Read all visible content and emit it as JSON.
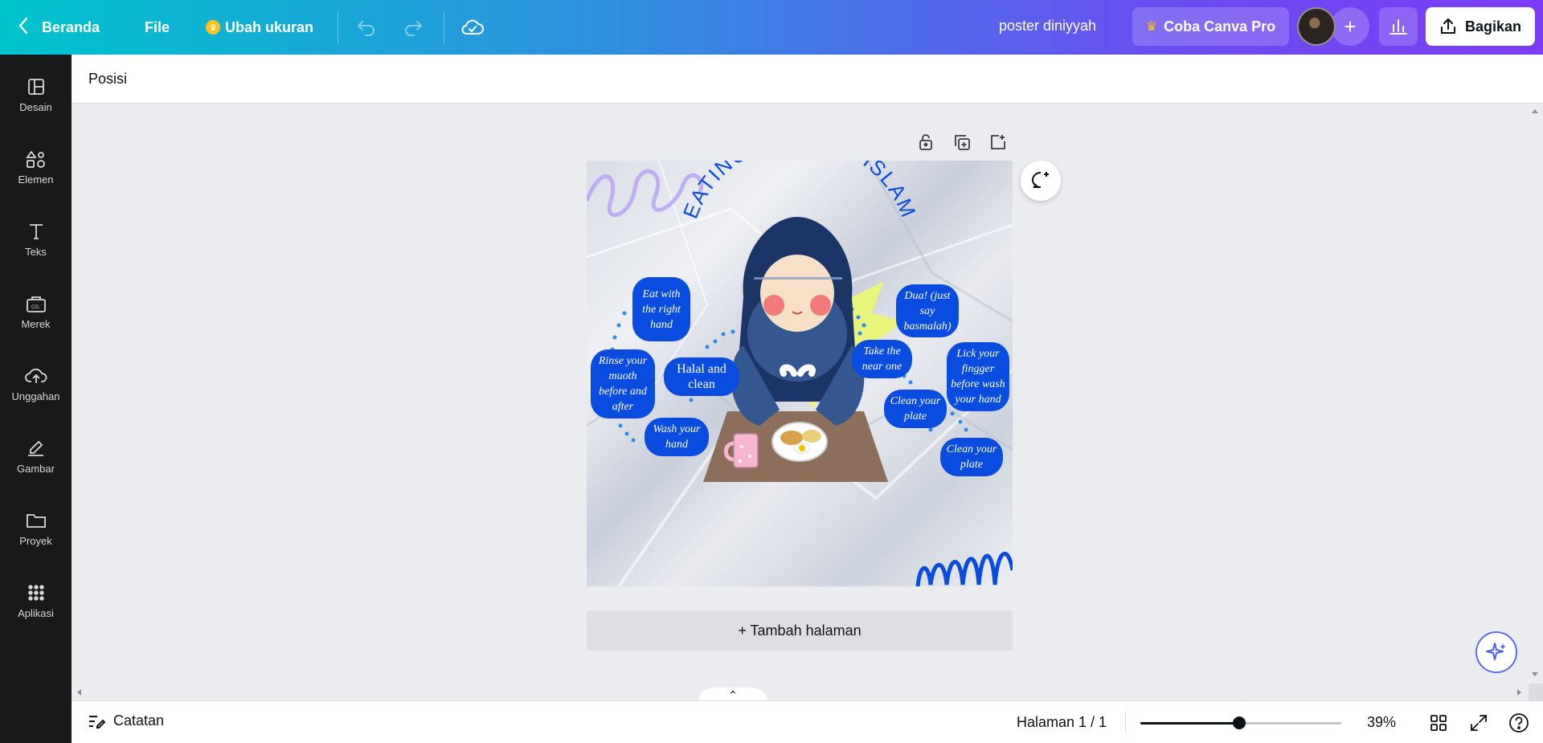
{
  "topbar": {
    "home_label": "Beranda",
    "file_label": "File",
    "resize_label": "Ubah ukuran",
    "doc_title": "poster diniyyah",
    "pro_label": "Coba Canva Pro",
    "share_label": "Bagikan"
  },
  "sidebar": {
    "items": [
      {
        "label": "Desain",
        "icon": "layout-icon"
      },
      {
        "label": "Elemen",
        "icon": "shapes-icon"
      },
      {
        "label": "Teks",
        "icon": "text-icon"
      },
      {
        "label": "Merek",
        "icon": "brand-icon"
      },
      {
        "label": "Unggahan",
        "icon": "upload-cloud-icon"
      },
      {
        "label": "Gambar",
        "icon": "draw-icon"
      },
      {
        "label": "Proyek",
        "icon": "folder-icon"
      },
      {
        "label": "Aplikasi",
        "icon": "apps-grid-icon"
      }
    ]
  },
  "subbar": {
    "position_label": "Posisi"
  },
  "design": {
    "title": "EATING ETHIC IN ISLAM",
    "bubbles": {
      "right_hand": "Eat with the right hand",
      "rinse": "Rinse your muoth before and after",
      "halal": "Halal and clean",
      "wash": "Wash your hand",
      "dua": "Dua! (just say basmalah)",
      "near": "Take the near one",
      "lick": "Lick your fingger before wash your hand",
      "plate1": "Clean your plate",
      "plate2": "Clean your plate"
    },
    "colors": {
      "accent": "#0a4be0",
      "hijab": "#1b3566",
      "burst": "#e9f57a"
    }
  },
  "canvas": {
    "add_page_label": "+ Tambah halaman"
  },
  "footer": {
    "notes_label": "Catatan",
    "page_label": "Halaman 1 / 1",
    "zoom_label": "39%",
    "zoom_fraction": 0.39
  }
}
